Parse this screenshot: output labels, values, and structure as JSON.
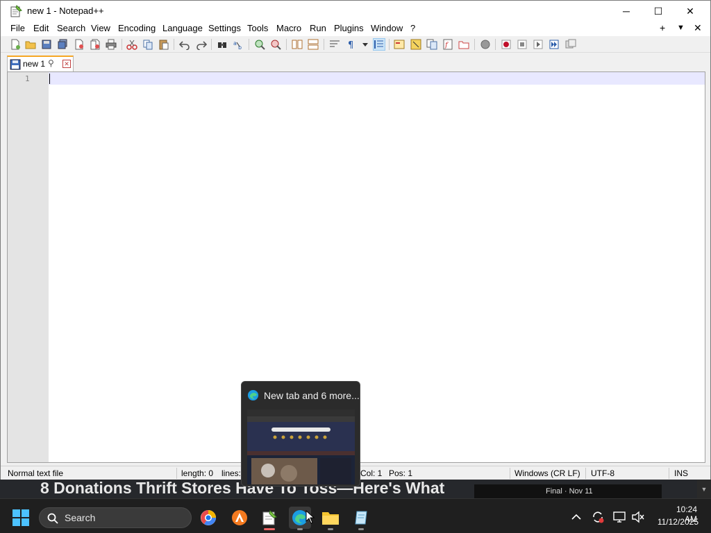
{
  "window": {
    "title": "new 1 - Notepad++",
    "controls": {
      "minimize": "─",
      "maximize": "☐",
      "close": "✕"
    }
  },
  "menu": {
    "items": [
      "File",
      "Edit",
      "Search",
      "View",
      "Encoding",
      "Language",
      "Settings",
      "Tools",
      "Macro",
      "Run",
      "Plugins",
      "Window",
      "?"
    ],
    "right": {
      "add": "+",
      "dropdown": "▼",
      "close": "✕"
    }
  },
  "tab": {
    "label": "new 1",
    "pin": "✎"
  },
  "editor": {
    "line_numbers": [
      "1"
    ],
    "content": ""
  },
  "statusbar": {
    "file_type": "Normal text file",
    "length": "length: 0",
    "lines": "lines:",
    "col": "Col: 1",
    "pos": "Pos: 1",
    "eol": "Windows (CR LF)",
    "encoding": "UTF-8",
    "mode": "INS"
  },
  "background": {
    "headline": "8 Donations Thrift Stores Have To Toss—Here's What",
    "card_text": "Final · Nov 11"
  },
  "preview": {
    "title": "New tab and 6 more..."
  },
  "taskbar": {
    "search_label": "Search",
    "clock": {
      "time": "10:24 AM",
      "date": "11/12/2025"
    }
  },
  "colors": {
    "accent": "#f6a623",
    "current_line": "#e8e8ff",
    "taskbar": "#1f1f1f"
  }
}
